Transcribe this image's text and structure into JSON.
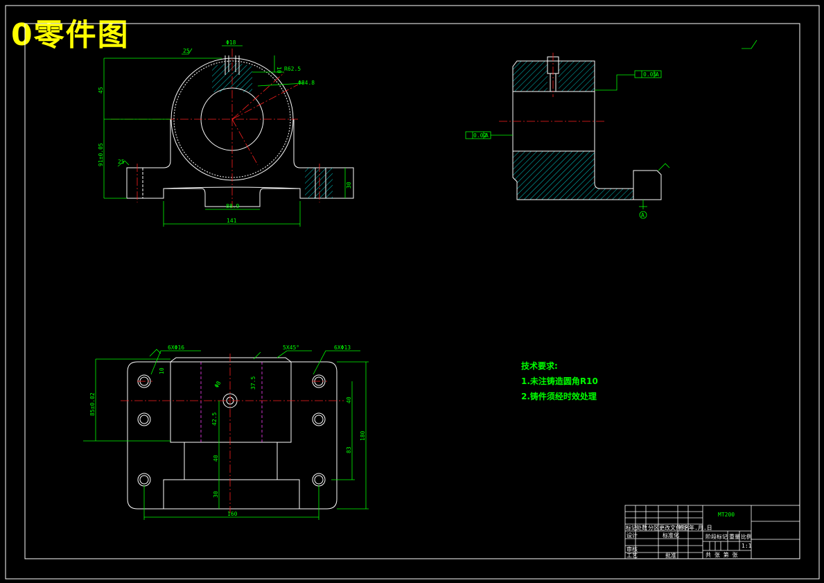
{
  "title": "0零件图",
  "tech": {
    "heading": "技术要求:",
    "req1": "1.未注铸造圆角R10",
    "req2": "2.铸件须经时效处理"
  },
  "material": "MT200",
  "front_view": {
    "d_top_hole": "Φ18",
    "d_top_depth": "10",
    "r_outer": "R62.5",
    "d_bore": "Φ84.8",
    "h_top": "45",
    "h_total": "91±0.05",
    "w_slot": "88.9",
    "w_base": "141",
    "h_foot": "30",
    "rough_top": "25",
    "rough_left": "25"
  },
  "top_view": {
    "holes_left": "6XΦ16",
    "chamfer": "5X45°",
    "holes_right": "6XΦ13",
    "w_total": "160",
    "h_total": "180",
    "h_block": "85±0.02",
    "d_pin": "Φ8",
    "d_40": "40",
    "d_30": "30",
    "d_83": "83",
    "d_10": "10",
    "d_37": "37.5",
    "d_42": "42.5"
  },
  "side_view": {
    "flatness_tol": "0.05",
    "perp_tol": "0.02",
    "datum": "A"
  },
  "title_block": {
    "h1": "标记",
    "h2": "处数",
    "h3": "分区",
    "h4": "更改文件号",
    "h5": "签名",
    "h6": "年.月.日",
    "design": "设计",
    "std": "标准化",
    "audit": "审核",
    "craft": "工艺",
    "approve": "批准",
    "stage": "阶段标记",
    "weight": "重量",
    "ratio": "比例",
    "scale": "1:1",
    "sheets": "共  张  第  张"
  }
}
